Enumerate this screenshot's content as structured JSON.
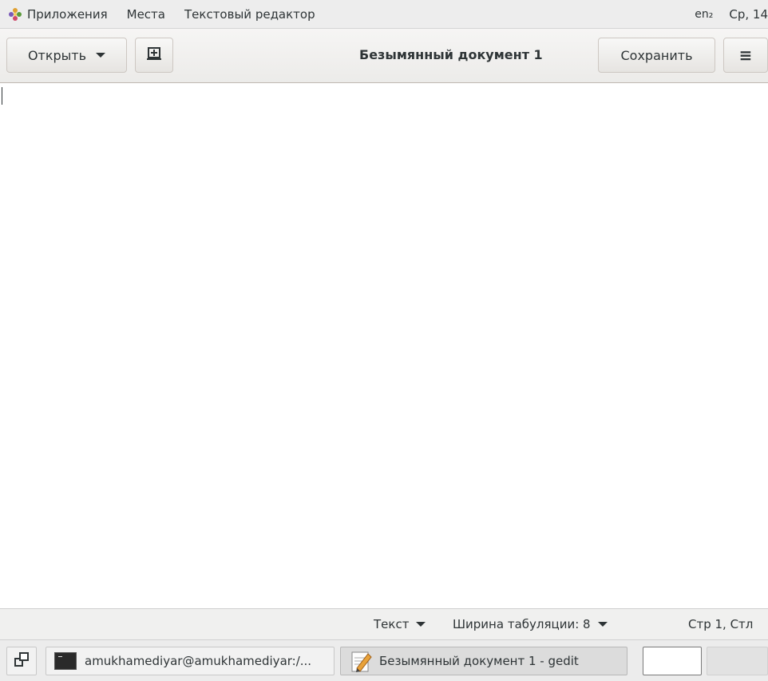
{
  "top_panel": {
    "applications": "Приложения",
    "places": "Места",
    "app_name": "Текстовый редактор",
    "lang": "en₂",
    "clock": "Ср, 14"
  },
  "header": {
    "open_label": "Открыть",
    "title": "Безымянный документ 1",
    "save_label": "Сохранить",
    "menu_icon": "≡"
  },
  "editor": {
    "content": ""
  },
  "statusbar": {
    "language": "Текст",
    "tab_width": "Ширина табуляции: 8",
    "position": "Стр 1, Стл"
  },
  "taskbar": {
    "terminal_task": "amukhamediyar@amukhamediyar:/...",
    "gedit_task": "Безымянный документ 1 - gedit"
  }
}
